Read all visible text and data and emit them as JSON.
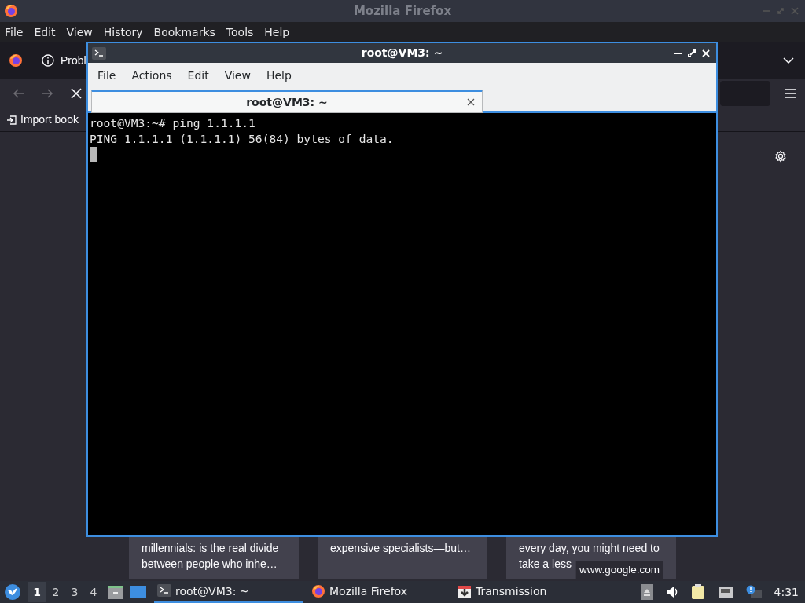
{
  "firefox": {
    "title": "Mozilla Firefox",
    "menu": [
      "File",
      "Edit",
      "View",
      "History",
      "Bookmarks",
      "Tools",
      "Help"
    ],
    "tab": {
      "label": "Probl"
    },
    "bookmarks": [
      {
        "label": "Import book"
      }
    ],
    "cards": [
      {
        "lines": [
          "millennials: is the real divide",
          "between people who inhe…"
        ]
      },
      {
        "lines": [
          "expensive specialists—but…"
        ]
      },
      {
        "lines": [
          "every day, you might need to",
          "take a less"
        ]
      }
    ],
    "tooltip": "www.google.com"
  },
  "terminal": {
    "title": "root@VM3: ~",
    "menu": [
      "File",
      "Actions",
      "Edit",
      "View",
      "Help"
    ],
    "tabs": [
      {
        "label": "root@VM3: ~",
        "selected": true
      }
    ],
    "lines": [
      "root@VM3:~# ping 1.1.1.1",
      "PING 1.1.1.1 (1.1.1.1) 56(84) bytes of data."
    ]
  },
  "taskbar": {
    "workspaces": [
      {
        "label": "1",
        "selected": true
      },
      {
        "label": "2",
        "selected": false
      },
      {
        "label": "3",
        "selected": false
      },
      {
        "label": "4",
        "selected": false
      }
    ],
    "tasks": [
      {
        "kind": "terminal",
        "label": "root@VM3: ~",
        "selected": true
      },
      {
        "kind": "firefox",
        "label": "Mozilla Firefox",
        "selected": false
      },
      {
        "kind": "transmission",
        "label": "Transmission",
        "selected": false
      }
    ],
    "clock": "4:31"
  }
}
